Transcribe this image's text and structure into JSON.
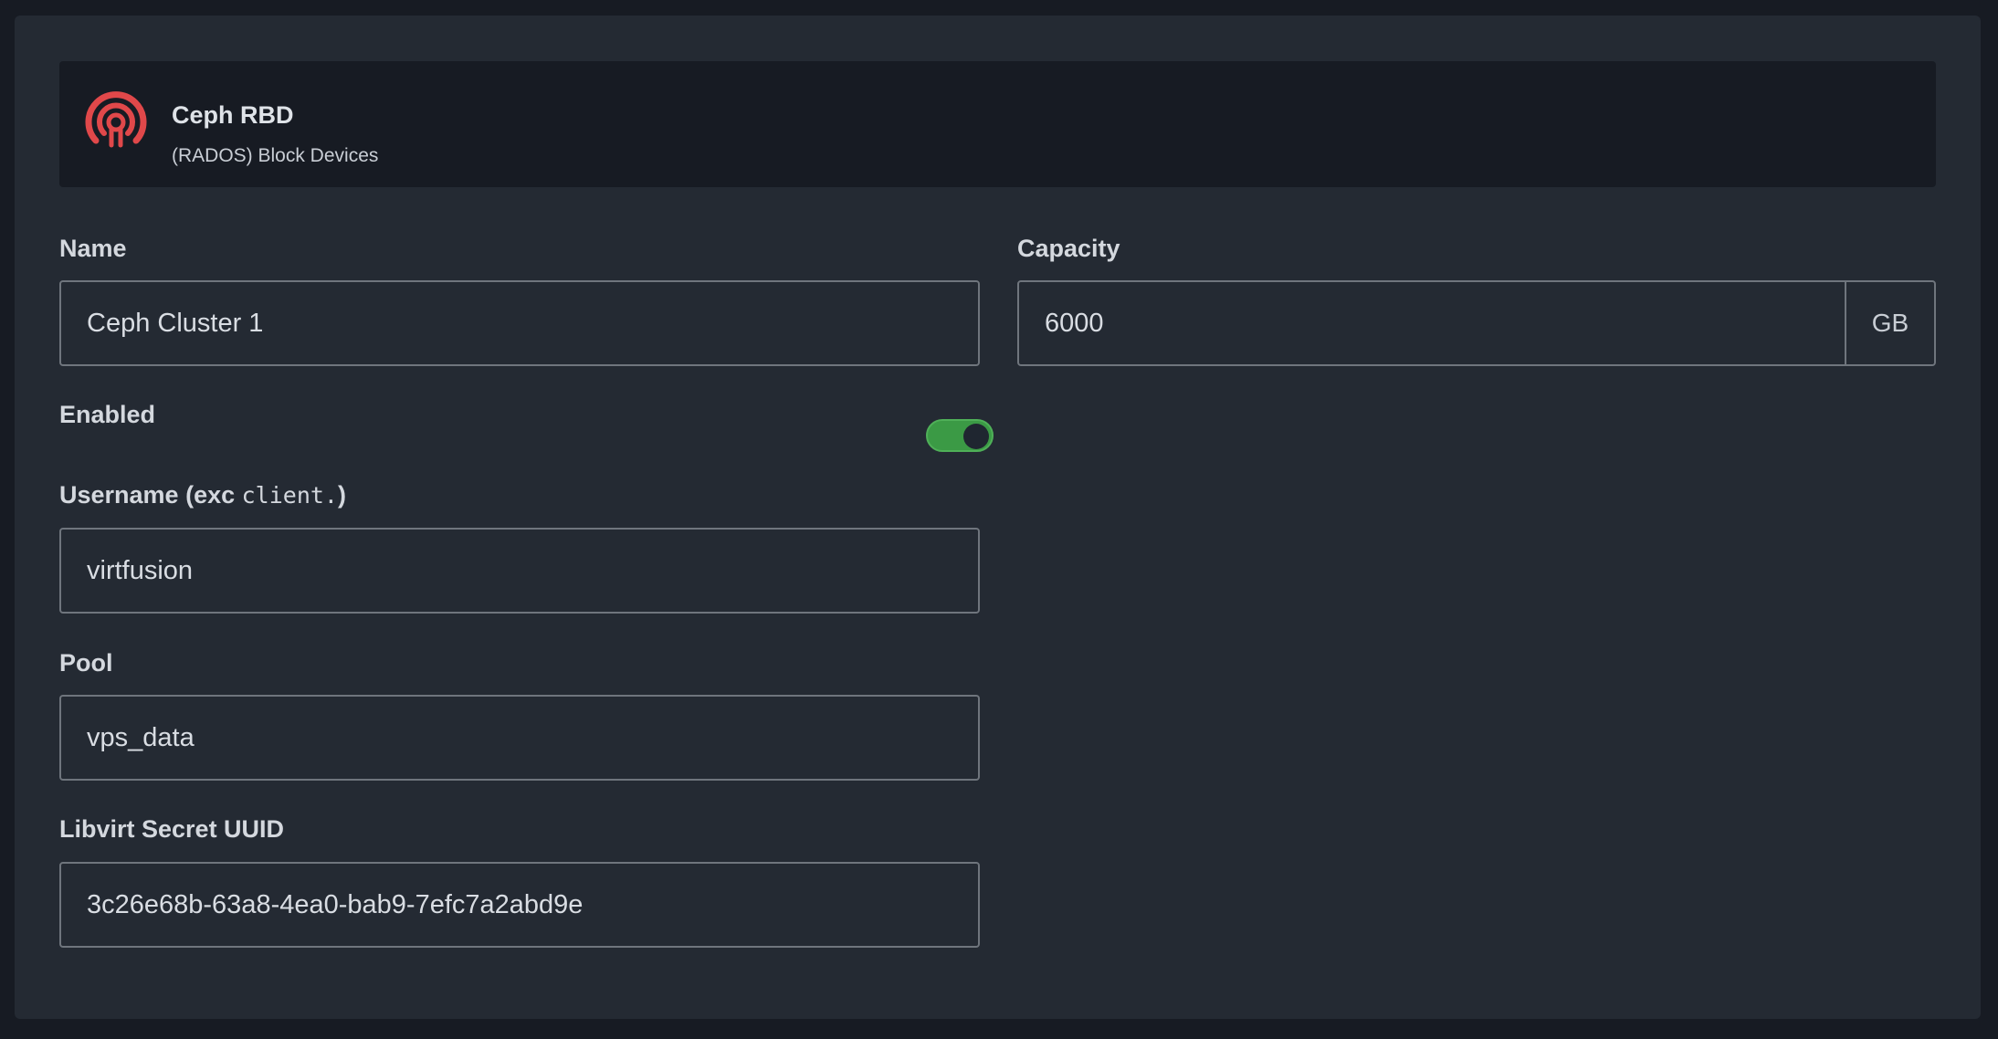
{
  "header": {
    "title": "Ceph RBD",
    "subtitle": "(RADOS) Block Devices",
    "logo_color": "#e0484a"
  },
  "form": {
    "name": {
      "label": "Name",
      "value": "Ceph Cluster 1"
    },
    "capacity": {
      "label": "Capacity",
      "value": "6000",
      "unit": "GB"
    },
    "enabled": {
      "label": "Enabled",
      "state": "on",
      "color": "#3b9a45"
    },
    "username": {
      "label_prefix": "Username (exc ",
      "label_code": "client.",
      "label_suffix": ")",
      "value": "virtfusion"
    },
    "pool": {
      "label": "Pool",
      "value": "vps_data"
    },
    "secret": {
      "label": "Libvirt Secret UUID",
      "value": "3c26e68b-63a8-4ea0-bab9-7efc7a2abd9e"
    }
  }
}
